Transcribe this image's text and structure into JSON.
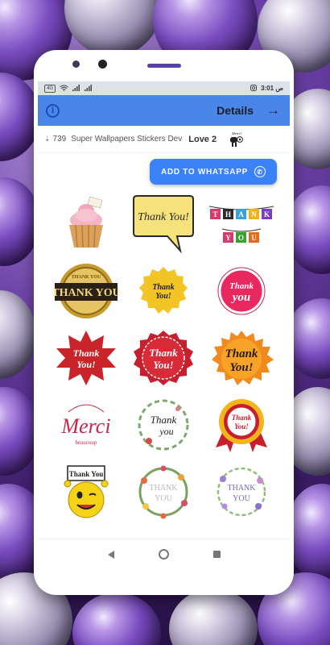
{
  "status_bar": {
    "badge": "4G",
    "right_text": "ص 3:01"
  },
  "app_bar": {
    "title": "Details"
  },
  "pack": {
    "downloads": "739",
    "developer": "Super Wallpapers Stickers Dev",
    "name": "Love 2",
    "tray_label": "Merci!"
  },
  "actions": {
    "whatsapp_label": "ADD TO WHATSAPP"
  },
  "stickers": {
    "s2": "Thank You!",
    "s3": [
      "T",
      "H",
      "A",
      "N",
      "K"
    ],
    "s3b": [
      "Y",
      "O",
      "U"
    ],
    "s4a": "THANK YOU",
    "s4b": "THANK YOU",
    "s5a": "Thank",
    "s5b": "You!",
    "s6a": "Thank",
    "s6b": "you",
    "s7a": "Thank",
    "s7b": "You!",
    "s8a": "Thank",
    "s8b": "You!",
    "s9a": "Thank",
    "s9b": "You!",
    "s10a": "Merci",
    "s10b": "beaucoup",
    "s11a": "Thank",
    "s11b": "you",
    "s12a": "Thank",
    "s12b": "You!",
    "s13": "Thank You",
    "s14a": "THANK",
    "s14b": "YOU",
    "s15a": "THANK",
    "s15b": "YOU"
  },
  "colors": {
    "app_bar": "#4a86e8",
    "button": "#3b82f6"
  }
}
